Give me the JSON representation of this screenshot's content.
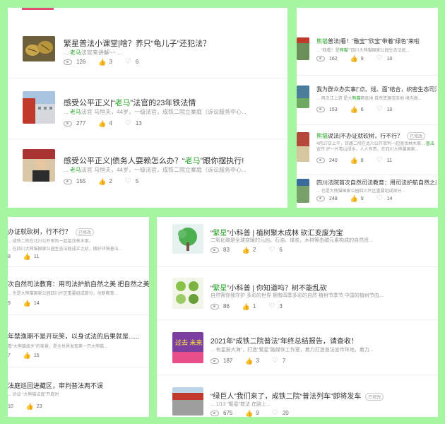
{
  "panel_a": {
    "items": [
      {
        "title_pre": "繁星普法小课堂|啥？养只“龟儿子”还犯法？",
        "title_hl": "",
        "title_post": "",
        "sub_pre": "... ",
        "sub_hl": "老马",
        "sub_post": "法官来讲解~~ ...",
        "views": "126",
        "likes": "3",
        "favs": "6"
      },
      {
        "title_pre": "感受公平正义|“",
        "title_hl": "老马",
        "title_post": "”法官的23年铁法情",
        "sub_pre": "... ",
        "sub_hl": "老马",
        "sub_post": "法官 马恒夫，44岁，一级法官，成铁二院立案庭（诉讼服务中心...",
        "views": "277",
        "likes": "4",
        "favs": "13"
      },
      {
        "title_pre": "感受公平正义|债务人耍赖怎么办？“",
        "title_hl": "老马",
        "title_post": "”跟你摆执行!",
        "sub_pre": "... ",
        "sub_hl": "老马",
        "sub_post": "法官 马恒夫，44岁，一级法官，成铁二院立案庭（诉讼服务中心...",
        "views": "155",
        "likes": "2",
        "favs": "5"
      }
    ]
  },
  "panel_b": {
    "items": [
      {
        "title_pre": "",
        "title_hl": "熊猫",
        "title_post": "普法|看！“融宝”“欣宝”带着“绿色”来啦",
        "sub_pre": "... “我看！是",
        "sub_hl": "熊猫",
        "sub_post": "”“四川大熊猫国家公园生态法庭...",
        "views": "162",
        "likes": "9",
        "favs": "10"
      },
      {
        "title_pre": "我为群众办实事|“点、线、面”结合，织密生态司法屏",
        "title_hl": "",
        "title_post": "",
        "sub_pre": "... 再次江上游 是大",
        "sub_hl": "熊猫",
        "sub_post": "栖息地 自然资源宝库地 境内高...",
        "views": "153",
        "likes": "6",
        "favs": "10"
      },
      {
        "title_pre": "",
        "title_hl": "熊猫",
        "title_post": "说法|不办证就砍树，行不行？",
        "sub_pre": "4月27日上午，铁路二院在北川公开审判一起滥伐林木案... ",
        "sub_hl": "普法",
        "sub_post": "宣传 护一片青山绿水，人人有责，在四川大熊猫国家...",
        "views": "240",
        "likes": "8",
        "favs": "11"
      },
      {
        "title_pre": "四川法院首次自然司法教育：用司法护航自然之美",
        "title_hl": "",
        "title_post": "",
        "sub_pre": "... 也是大熊猫国家公园四川片区重要组成部分...",
        "sub_hl": "",
        "sub_post": "",
        "views": "248",
        "likes": "9",
        "favs": "14"
      }
    ],
    "badge": "已修改"
  },
  "panel_c": {
    "items": [
      {
        "title": "办证就砍树，行不行？",
        "sub": "... 成铁二院在北川公开审判一起滥伐林木案。",
        "sub2": "... 在四川大熊猫国家公园生态法庭成立之初，做好环境普法...",
        "likes": "8",
        "favs": "11"
      },
      {
        "title": "次自然司法教育：用司法护航自然之美 把自然之美讲给",
        "sub": "... 也是大熊猫国家公园四川片区重要组成部分，创新教育...",
        "sub2": "",
        "likes": "9",
        "favs": "14"
      },
      {
        "title": "年禁渔期不是开玩笑，以身试法的后果就是......",
        "sub": "看“大熊猫故乡”的美景，是全世界发现第一只大熊猫...",
        "sub2": "",
        "likes": "7",
        "favs": "15"
      },
      {
        "title": "法庭巡回进藏区，审判普法两不误",
        "sub": "... 协议 “大熊猫法庭”开庭时",
        "sub2": "",
        "likes": "10",
        "favs": "23"
      }
    ],
    "badge": "已修改"
  },
  "panel_d": {
    "items": [
      {
        "title_pre": "“",
        "title_hl": "繁星",
        "title_post": "”小科普 | 植树聚木成林 砍汇变废为宝",
        "sub": "二氧化碳是全球变暖的元凶。石油、煤炭，木材等由碳元素构成的自然资...",
        "views": "83",
        "likes": "2",
        "favs": "6"
      },
      {
        "title_pre": "“",
        "title_hl": "繁星",
        "title_post": "”小科普 | 你知道吗？树不能乱砍",
        "sub": "自然需你我守护 多彩的世界 拥有四季多彩的自然 植树节季节 中国的植树节由...",
        "views": "86",
        "likes": "1",
        "favs": "3"
      },
      {
        "title_pre": "2021年“成铁二院普法”年终总结报告，请查收！",
        "title_hl": "",
        "title_post": "",
        "sub": "... 有星辰大海”，打造“繁星”融媒体工作室，着力打造普法宣传阵地，着力...",
        "views": "187",
        "likes": "3",
        "favs": "7"
      },
      {
        "title_pre": "“绿巨人”我们来了，成铁二院“普法列车”即将发车",
        "title_hl": "",
        "title_post": "",
        "sub": "... 1/13 “繁星”普法 在路上...",
        "views": "675",
        "likes": "9",
        "favs": "20"
      }
    ],
    "badge": "已修改",
    "thumb3_text": "过去 未来"
  },
  "icons": [
    "eye-icon",
    "thumbs-up-icon",
    "heart-icon"
  ],
  "colors": {
    "background": "#a6f5a0",
    "highlight": "#2aa52a",
    "text": "#333333",
    "muted": "#999999"
  }
}
